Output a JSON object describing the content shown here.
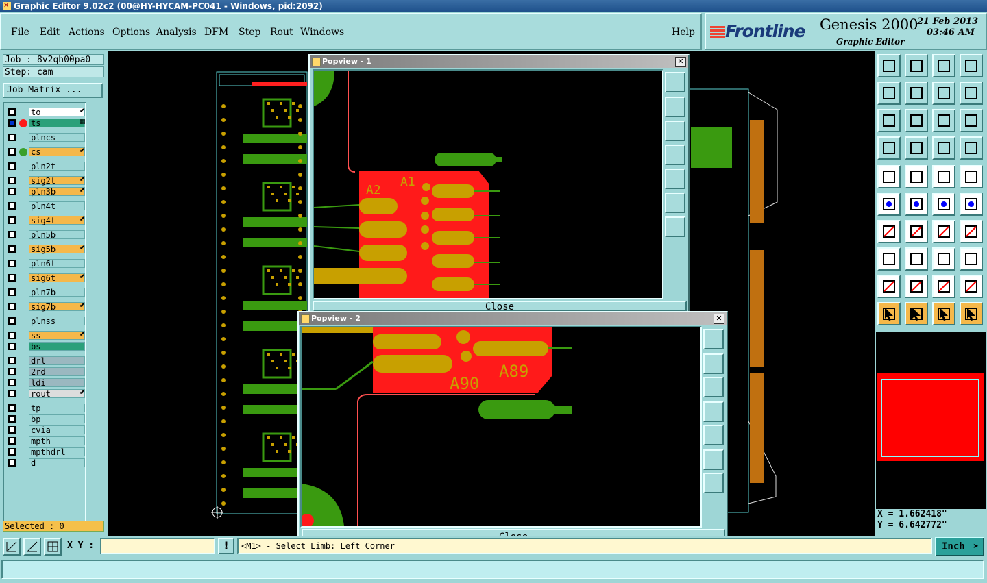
{
  "window": {
    "title": "Graphic Editor 9.02c2 (00@HY-HYCAM-PC041 - Windows, pid:2092)"
  },
  "menu": {
    "items": [
      "File",
      "Edit",
      "Actions",
      "Options",
      "Analysis",
      "DFM",
      "Step",
      "Rout",
      "Windows"
    ],
    "help": "Help"
  },
  "brand": {
    "logo": "Frontline",
    "product": "Genesis 2000",
    "subtitle": "Graphic Editor",
    "date": "21 Feb 2013",
    "time": "03:46 AM"
  },
  "job": {
    "job_label": "Job : 8v2qh00pa0",
    "step_label": "Step: cam",
    "matrix_button": "Job Matrix ..."
  },
  "layers": [
    {
      "name": "to",
      "color": "#ffffff",
      "arrow": "⬋"
    },
    {
      "name": "ts",
      "color": "#2aa07a",
      "arrow": "▦",
      "active": true
    },
    {
      "name": "plncs",
      "color": "#9ed6d6",
      "arrow": ""
    },
    {
      "name": "cs",
      "color": "#f5b84a",
      "arrow": "⬋",
      "dot": "#3aa02a"
    },
    {
      "name": "pln2t",
      "color": "#9ed6d6",
      "arrow": ""
    },
    {
      "name": "sig2t",
      "color": "#f5b84a",
      "arrow": "⬋"
    },
    {
      "name": "pln3b",
      "color": "#f5b84a",
      "arrow": "⬋"
    },
    {
      "name": "pln4t",
      "color": "#9ed6d6",
      "arrow": ""
    },
    {
      "name": "sig4t",
      "color": "#f5b84a",
      "arrow": "⬋"
    },
    {
      "name": "pln5b",
      "color": "#9ed6d6",
      "arrow": ""
    },
    {
      "name": "sig5b",
      "color": "#f5b84a",
      "arrow": "⬋"
    },
    {
      "name": "pln6t",
      "color": "#9ed6d6",
      "arrow": ""
    },
    {
      "name": "sig6t",
      "color": "#f5b84a",
      "arrow": "⬋"
    },
    {
      "name": "pln7b",
      "color": "#9ed6d6",
      "arrow": ""
    },
    {
      "name": "sig7b",
      "color": "#f5b84a",
      "arrow": "⬋"
    },
    {
      "name": "plnss",
      "color": "#9ed6d6",
      "arrow": ""
    },
    {
      "name": "ss",
      "color": "#f5b84a",
      "arrow": "⬋"
    },
    {
      "name": "bs",
      "color": "#2aa07a",
      "arrow": ""
    },
    {
      "name": "drl",
      "color": "#9ab8c0",
      "arrow": ""
    },
    {
      "name": "2rd",
      "color": "#9ab8c0",
      "arrow": ""
    },
    {
      "name": "ldi",
      "color": "#9ab8c0",
      "arrow": ""
    },
    {
      "name": "rout",
      "color": "#dddddd",
      "arrow": "⬋"
    },
    {
      "name": "tp",
      "color": "#9ed6d6",
      "arrow": ""
    },
    {
      "name": "bp",
      "color": "#9ed6d6",
      "arrow": ""
    },
    {
      "name": "cvia",
      "color": "#9ed6d6",
      "arrow": ""
    },
    {
      "name": "mpth",
      "color": "#9ed6d6",
      "arrow": ""
    },
    {
      "name": "mpthdrl",
      "color": "#9ed6d6",
      "arrow": ""
    },
    {
      "name": "d",
      "color": "#9ed6d6",
      "arrow": ""
    }
  ],
  "selected": "Selected : 0",
  "popups": [
    {
      "title": "Popview - 1",
      "close": "Close",
      "labels": [
        "A2",
        "A1"
      ]
    },
    {
      "title": "Popview - 2",
      "close": "Close",
      "labels": [
        "A90",
        "A89"
      ]
    }
  ],
  "coords": {
    "x": "X =  1.662418\"",
    "y": "Y =  6.642772\""
  },
  "bottom": {
    "xy_label": "X Y :",
    "xy_value": "",
    "status": "<M1> - Select Limb: Left Corner",
    "units": "Inch",
    "bang": "!"
  },
  "icons": {
    "toolbar": [
      "home-icon",
      "down-icon",
      "house-icon",
      "window-icon",
      "pan-left-icon",
      "pan-right-icon",
      "swap-icon",
      "redraw-icon",
      "fit-icon",
      "zoom-icon",
      "scale-icon",
      "help-icon",
      "settings-icon",
      "grid-icon",
      "layers-icon",
      "snap-icon",
      "feature-icon",
      "corner-icon",
      "measure-icon",
      "pad-icon",
      "connect-icon",
      "cross-icon",
      "move-icon",
      "move-red-icon",
      "line-icon",
      "slash-icon",
      "arc-icon",
      "text-icon",
      "polygon-icon",
      "minus-icon",
      "dim-icon",
      "shapes-icon",
      "triangle-icon",
      "triangle-a-icon",
      "triangle-box-icon",
      "triangle-flat-icon",
      "pointer-icon",
      "pointer-box-icon",
      "pointer-sel-icon",
      "pointer-net-icon"
    ]
  },
  "colors": {
    "panel": "#9ed6d6",
    "canvas": "#000000",
    "copper": "#ff1a1a",
    "pad": "#c8a000",
    "trace": "#3a9a10",
    "outline": "#6ee0e0"
  }
}
